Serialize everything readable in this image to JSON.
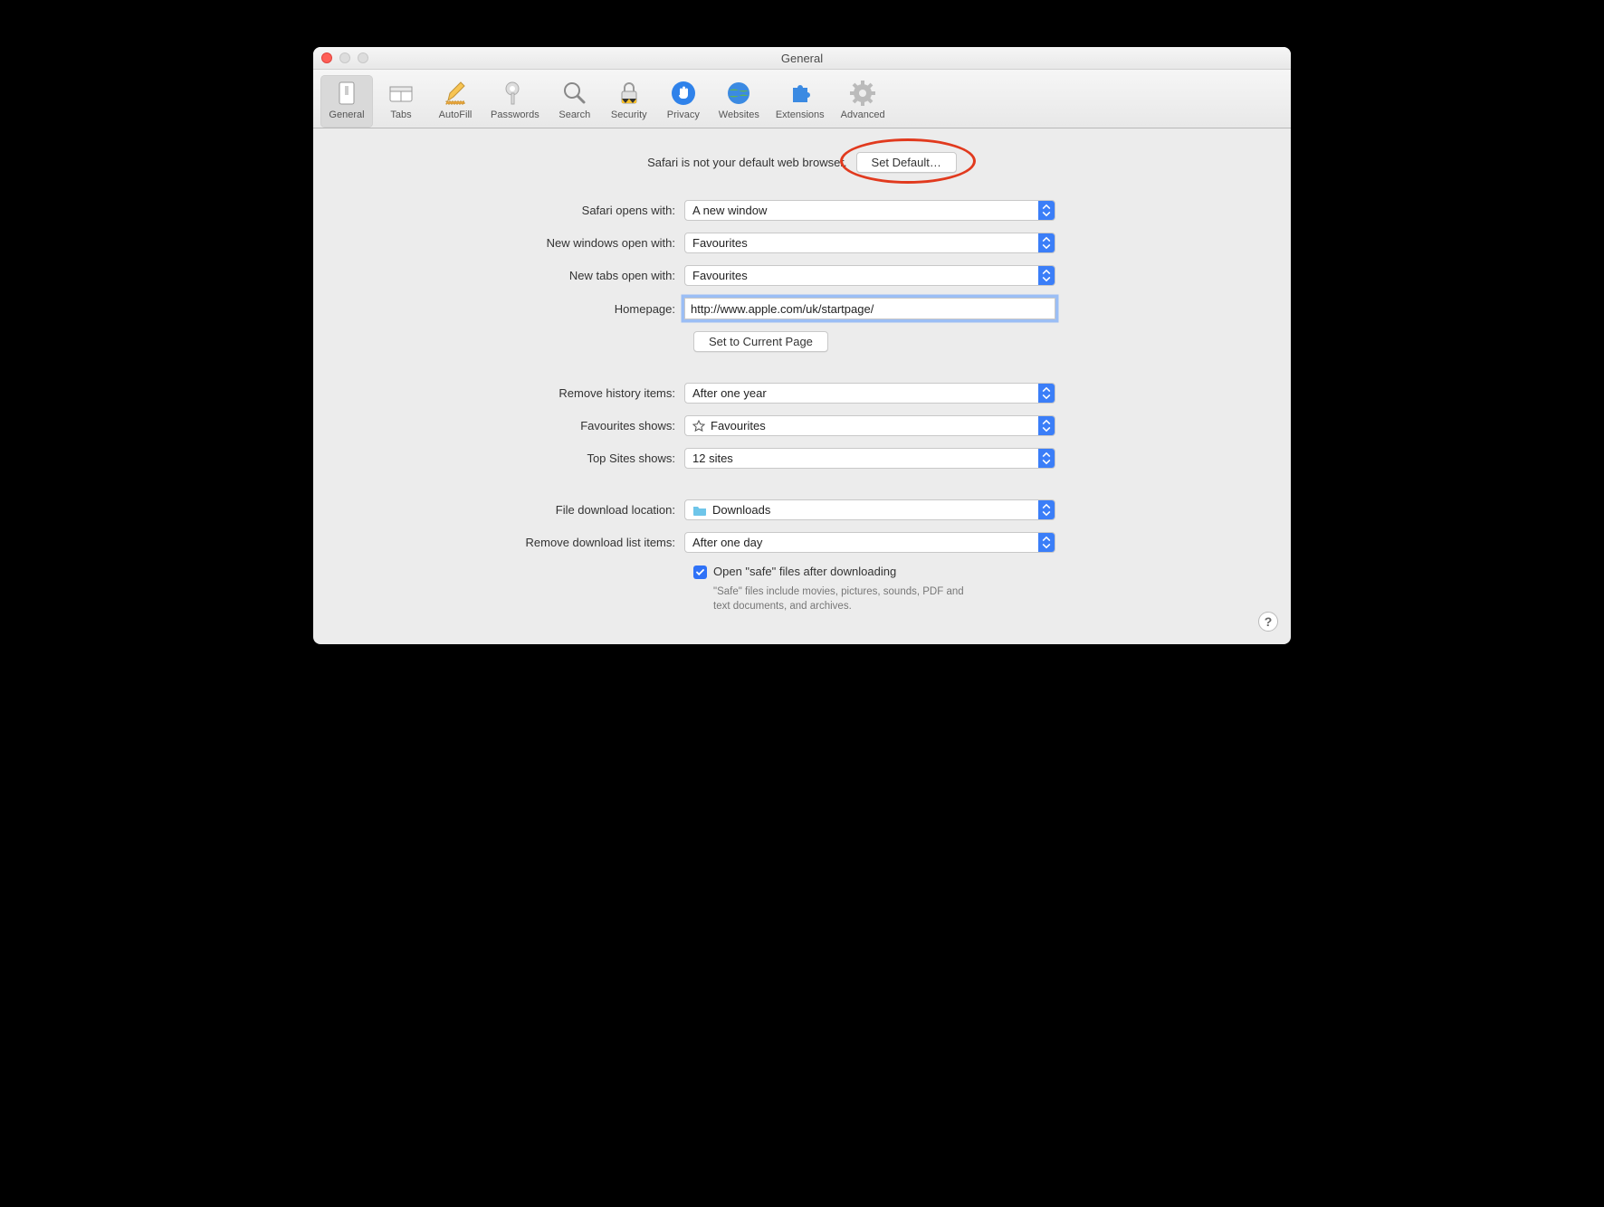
{
  "window_title": "General",
  "toolbar": [
    {
      "key": "general",
      "label": "General"
    },
    {
      "key": "tabs",
      "label": "Tabs"
    },
    {
      "key": "autofill",
      "label": "AutoFill"
    },
    {
      "key": "passwords",
      "label": "Passwords"
    },
    {
      "key": "search",
      "label": "Search"
    },
    {
      "key": "security",
      "label": "Security"
    },
    {
      "key": "privacy",
      "label": "Privacy"
    },
    {
      "key": "websites",
      "label": "Websites"
    },
    {
      "key": "extensions",
      "label": "Extensions"
    },
    {
      "key": "advanced",
      "label": "Advanced"
    }
  ],
  "banner": {
    "text": "Safari is not your default web browser.",
    "button": "Set Default…"
  },
  "labels": {
    "opens_with": "Safari opens with:",
    "new_windows": "New windows open with:",
    "new_tabs": "New tabs open with:",
    "homepage": "Homepage:",
    "remove_history": "Remove history items:",
    "favourites_shows": "Favourites shows:",
    "top_sites": "Top Sites shows:",
    "download_location": "File download location:",
    "remove_downloads": "Remove download list items:"
  },
  "values": {
    "opens_with": "A new window",
    "new_windows": "Favourites",
    "new_tabs": "Favourites",
    "homepage": "http://www.apple.com/uk/startpage/",
    "remove_history": "After one year",
    "favourites_shows": "Favourites",
    "top_sites": "12 sites",
    "download_location": "Downloads",
    "remove_downloads": "After one day"
  },
  "buttons": {
    "set_current": "Set to Current Page"
  },
  "checkbox": {
    "label": "Open \"safe\" files after downloading",
    "hint": "\"Safe\" files include movies, pictures, sounds, PDF and text documents, and archives."
  },
  "help_glyph": "?"
}
